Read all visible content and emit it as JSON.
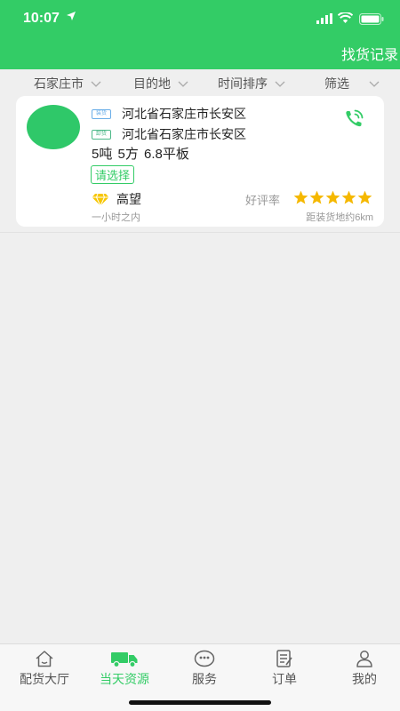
{
  "status_bar": {
    "time": "10:07"
  },
  "header": {
    "action_label": "找货记录"
  },
  "filters": [
    {
      "label": "石家庄市"
    },
    {
      "label": "目的地"
    },
    {
      "label": "时间排序"
    },
    {
      "label": "筛选"
    }
  ],
  "listing": {
    "origin_tag": "装货",
    "origin": "河北省石家庄市长安区",
    "destination_tag": "卸货",
    "destination": "河北省石家庄市长安区",
    "cargo": "5吨  5方 6.8平板",
    "select_label": "请选择",
    "reputation": "高望",
    "rating_label": "好评率",
    "rating": 5,
    "rating_max": 5,
    "posted": "一小时之内",
    "distance": "距装货地约6km"
  },
  "tabs": [
    {
      "label": "配货大厅",
      "icon": "home-icon",
      "active": false
    },
    {
      "label": "当天资源",
      "icon": "truck-icon",
      "active": true
    },
    {
      "label": "服务",
      "icon": "service-icon",
      "active": false
    },
    {
      "label": "订单",
      "icon": "order-icon",
      "active": false
    },
    {
      "label": "我的",
      "icon": "user-icon",
      "active": false
    }
  ],
  "colors": {
    "primary": "#33cc66",
    "star": "#f5b800",
    "background": "#efefef"
  }
}
